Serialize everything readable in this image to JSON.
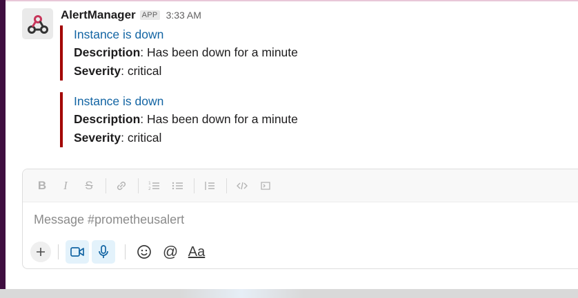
{
  "message": {
    "sender": "AlertManager",
    "badge": "APP",
    "time": "3:33 AM",
    "attachments": [
      {
        "title": "Instance is down",
        "description_label": "Description",
        "description_value": ": Has been down for a minute",
        "severity_label": "Severity",
        "severity_value": ": critical"
      },
      {
        "title": "Instance is down",
        "description_label": "Description",
        "description_value": ": Has been down for a minute",
        "severity_label": "Severity",
        "severity_value": ": critical"
      }
    ],
    "accent_color": "#a30200",
    "title_color": "#1264a3"
  },
  "composer": {
    "placeholder": "Message #prometheusalert",
    "format_buttons": [
      "bold-icon",
      "italic-icon",
      "strikethrough-icon",
      "link-icon",
      "ordered-list-icon",
      "bulleted-list-icon",
      "blockquote-icon",
      "code-icon",
      "code-block-icon"
    ],
    "text_format_label": "Aa"
  }
}
